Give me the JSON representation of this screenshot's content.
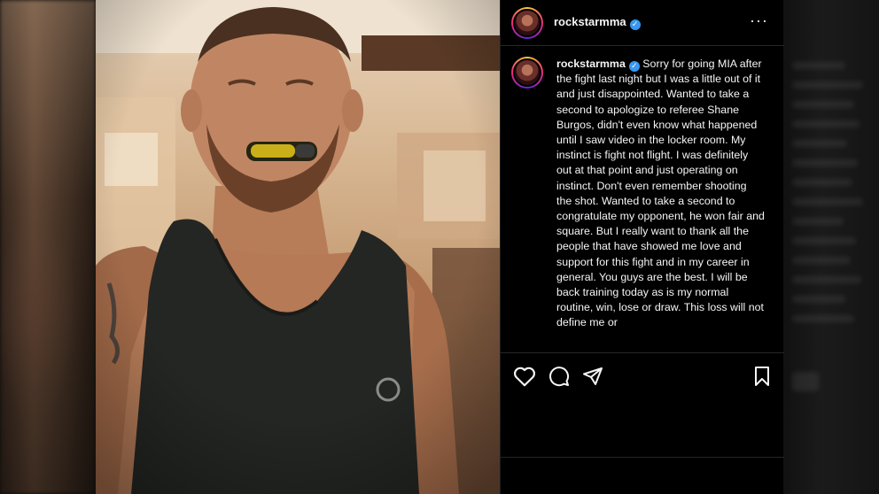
{
  "post": {
    "username": "rockstarmma",
    "verified_glyph": "✓",
    "more_glyph": "···",
    "caption_text": "Sorry for going MIA after the fight last night but I was a little out of it and just disappointed. Wanted to take a second to apologize to referee Shane Burgos, didn't even know what happened until I saw video in the locker room. My instinct is fight not flight. I was definitely out at that point and just operating on instinct. Don't even remember shooting the shot. Wanted to take a second to congratulate my opponent, he won fair and square. But I really want to thank all the people that have showed me love and support for this fight and in my career in general. You guys are the best. I will be back training today as is my normal routine, win, lose or draw. This loss will not define me or"
  },
  "icons": {
    "like": "heart-icon",
    "comment": "comment-icon",
    "share": "share-icon",
    "save": "bookmark-icon",
    "more": "more-options-icon"
  },
  "colors": {
    "panel_bg": "#000000",
    "text": "#f5f5f5",
    "verified": "#3897f0",
    "divider": "#262626"
  }
}
